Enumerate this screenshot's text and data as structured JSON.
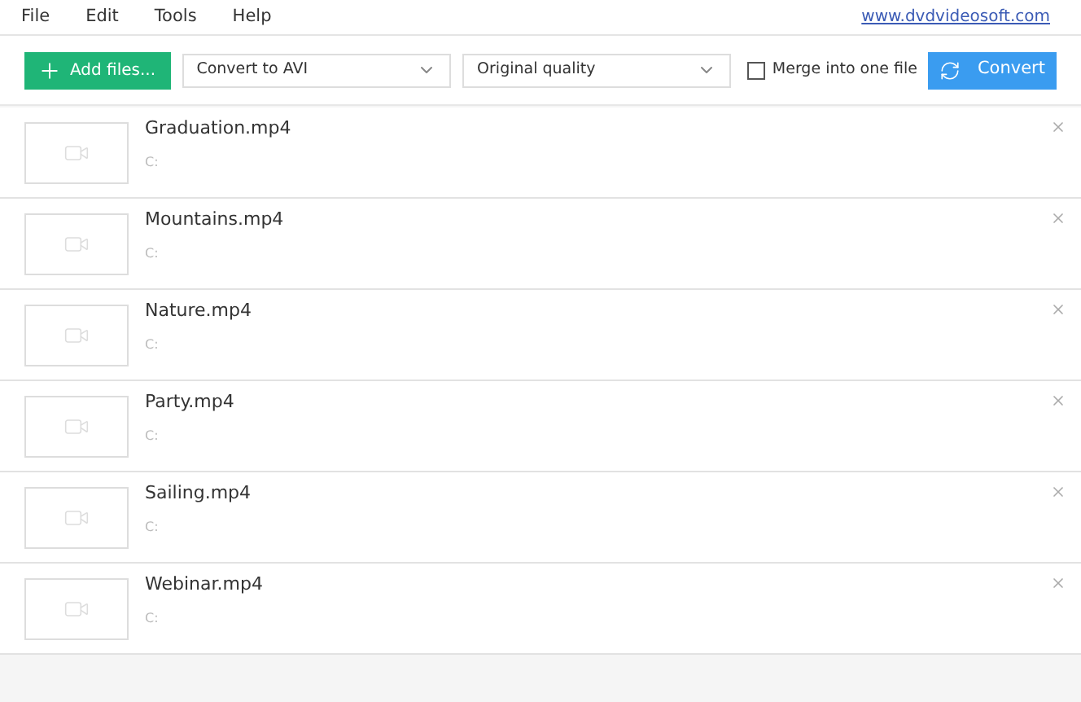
{
  "menu": [
    "File",
    "Edit",
    "Tools",
    "Help"
  ],
  "website_link": "www.dvdvideosoft.com",
  "toolbar": {
    "add_button": "Add files...",
    "format_select": "Convert to AVI",
    "quality_select": "Original quality",
    "merge": {
      "label": "Merge into one file",
      "checked": false
    },
    "convert_button": "Convert"
  },
  "files": [
    {
      "name": "Graduation.mp4",
      "path": "C:"
    },
    {
      "name": "Mountains.mp4",
      "path": "C:"
    },
    {
      "name": "Nature.mp4",
      "path": "C:"
    },
    {
      "name": "Party.mp4",
      "path": "C:"
    },
    {
      "name": "Sailing.mp4",
      "path": "C:"
    },
    {
      "name": "Webinar.mp4",
      "path": "C:"
    }
  ]
}
